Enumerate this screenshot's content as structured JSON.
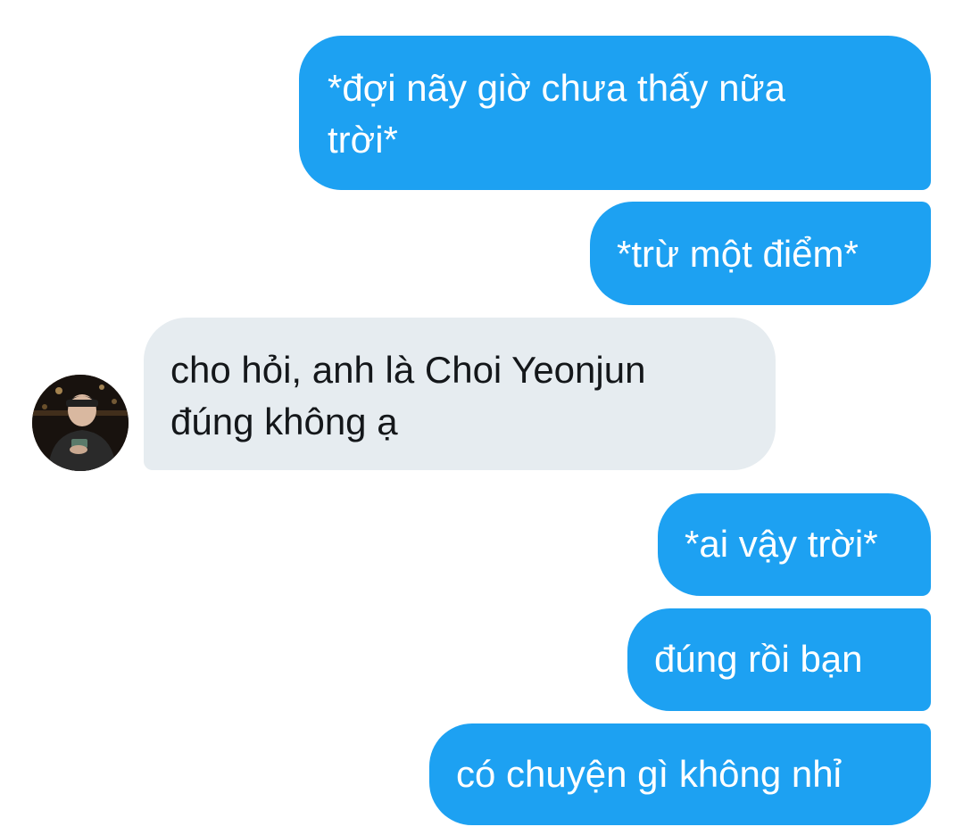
{
  "conversation": {
    "messages": [
      {
        "sender": "me",
        "text": "*đợi nãy giờ chưa thấy nữa\ntrời*"
      },
      {
        "sender": "me",
        "text": "*trừ một điểm*"
      },
      {
        "sender": "other",
        "text": "cho hỏi, anh là Choi Yeonjun\nđúng không ạ"
      },
      {
        "sender": "me",
        "text": "*ai vậy trời*"
      },
      {
        "sender": "me",
        "text": "đúng rồi bạn"
      },
      {
        "sender": "me",
        "text": "có chuyện gì không nhỉ"
      }
    ]
  },
  "colors": {
    "outgoing_bubble": "#1da1f2",
    "incoming_bubble": "#e6ecf0",
    "outgoing_text": "#ffffff",
    "incoming_text": "#14171a"
  },
  "icons": {
    "avatar": "profile-photo"
  }
}
